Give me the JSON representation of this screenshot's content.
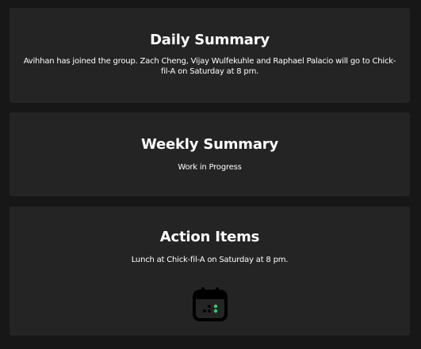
{
  "daily": {
    "title": "Daily Summary",
    "text": "Avihhan has joined the group. Zach Cheng, Vijay Wulfekuhle and Raphael Palacio will go to Chick-fil-A on Saturday at 8 pm."
  },
  "weekly": {
    "title": "Weekly Summary",
    "text": "Work in Progress"
  },
  "action": {
    "title": "Action Items",
    "text": "Lunch at Chick-fil-A on Saturday at 8 pm.",
    "icon": "calendar-icon"
  },
  "colors": {
    "background": "#171717",
    "card": "#242424",
    "text": "#ffffff",
    "icon_accent": "#2ecc71"
  }
}
